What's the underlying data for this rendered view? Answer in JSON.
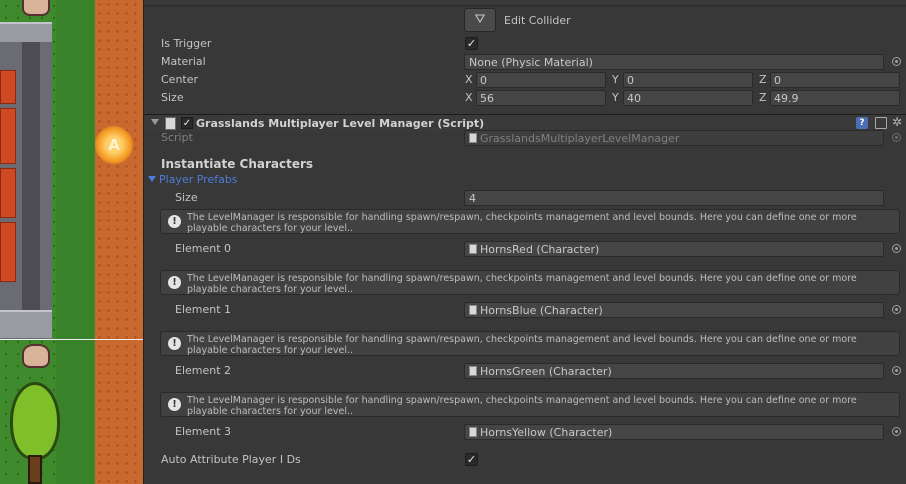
{
  "box_collider": {
    "edit_collider_label": "Edit Collider",
    "is_trigger_label": "Is Trigger",
    "is_trigger_checked": true,
    "material_label": "Material",
    "material_value": "None (Physic Material)",
    "center_label": "Center",
    "center": {
      "x": "0",
      "y": "0",
      "z": "0"
    },
    "size_label": "Size",
    "size": {
      "x": "56",
      "y": "40",
      "z": "49.9"
    },
    "axis_labels": {
      "x": "X",
      "y": "Y",
      "z": "Z"
    }
  },
  "component": {
    "title": "Grasslands Multiplayer Level Manager (Script)",
    "enabled": true,
    "script_label": "Script",
    "script_value": "GrasslandsMultiplayerLevelManager"
  },
  "section_title": "Instantiate Characters",
  "player_prefabs": {
    "label": "Player Prefabs",
    "size_label": "Size",
    "size_value": "4",
    "help_text": "The LevelManager is responsible for handling spawn/respawn, checkpoints management and level bounds. Here you can define one or more playable characters for your level..",
    "elements": [
      {
        "label": "Element 0",
        "value": "HornsRed (Character)"
      },
      {
        "label": "Element 1",
        "value": "HornsBlue (Character)"
      },
      {
        "label": "Element 2",
        "value": "HornsGreen (Character)"
      },
      {
        "label": "Element 3",
        "value": "HornsYellow (Character)"
      }
    ]
  },
  "auto_attribute": {
    "label": "Auto Attribute Player I Ds",
    "checked": true
  },
  "scene": {
    "coin_glyph": "A"
  },
  "icons": [
    "edit-collider-icon",
    "checkmark-icon",
    "object-picker-icon",
    "foldout-arrow-icon",
    "script-icon",
    "help-icon",
    "preset-icon",
    "gear-icon",
    "info-icon",
    "asset-icon"
  ],
  "colors": {
    "inspector_bg": "#383838",
    "field_bg": "#454545",
    "foldout_blue": "#4e7cd6",
    "scene_dirt": "#c9692f",
    "scene_grass": "#3f8a2c"
  }
}
